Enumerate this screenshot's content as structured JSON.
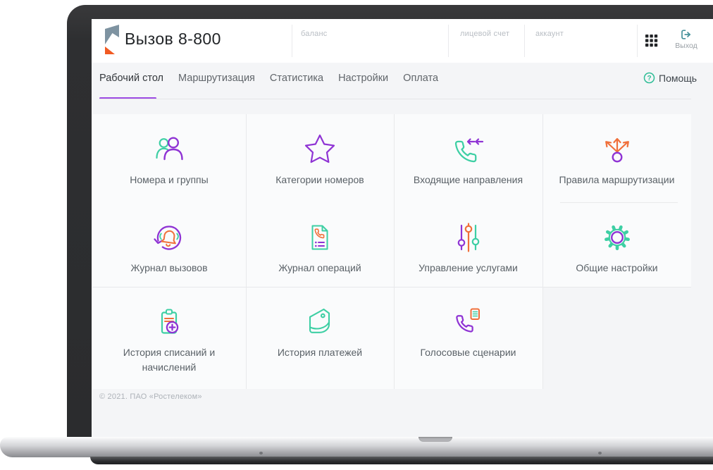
{
  "app": {
    "title": "Вызов 8-800"
  },
  "header": {
    "fields": [
      {
        "label": "баланс"
      },
      {
        "label": "лицевой счет"
      },
      {
        "label": "аккаунт"
      }
    ],
    "exit_label": "Выход"
  },
  "nav": {
    "tabs": [
      {
        "label": "Рабочий стол",
        "active": true
      },
      {
        "label": "Маршрутизация",
        "active": false
      },
      {
        "label": "Статистика",
        "active": false
      },
      {
        "label": "Настройки",
        "active": false
      },
      {
        "label": "Оплата",
        "active": false
      }
    ],
    "help_label": "Помощь"
  },
  "cards": [
    {
      "label": "Номера и группы",
      "icon": "people-group-icon"
    },
    {
      "label": "Категории номеров",
      "icon": "star-icon"
    },
    {
      "label": "Входящие направления",
      "icon": "incoming-call-icon"
    },
    {
      "label": "Правила маршрутизации",
      "icon": "routing-arrows-icon"
    },
    {
      "label": "Журнал вызовов",
      "icon": "call-log-icon"
    },
    {
      "label": "Журнал операций",
      "icon": "operations-log-icon"
    },
    {
      "label": "Управление услугами",
      "icon": "sliders-icon"
    },
    {
      "label": "Общие настройки",
      "icon": "gear-icon"
    },
    {
      "label": "История списаний и начислений",
      "icon": "clipboard-plus-icon"
    },
    {
      "label": "История платежей",
      "icon": "wallet-icon"
    },
    {
      "label": "Голосовые сценарии",
      "icon": "voice-scenario-icon"
    }
  ],
  "footer": {
    "copyright": "© 2021. ПАО «Ростелеком»"
  },
  "colors": {
    "purple": "#8F33D4",
    "teal": "#3ECFA4",
    "orange": "#F0703B",
    "tab_underline": "#9D4BE3",
    "help_green": "#2EBD96",
    "exit_teal": "#47929B",
    "logo_slate": "#7E93A1",
    "logo_orange": "#F15A22"
  }
}
